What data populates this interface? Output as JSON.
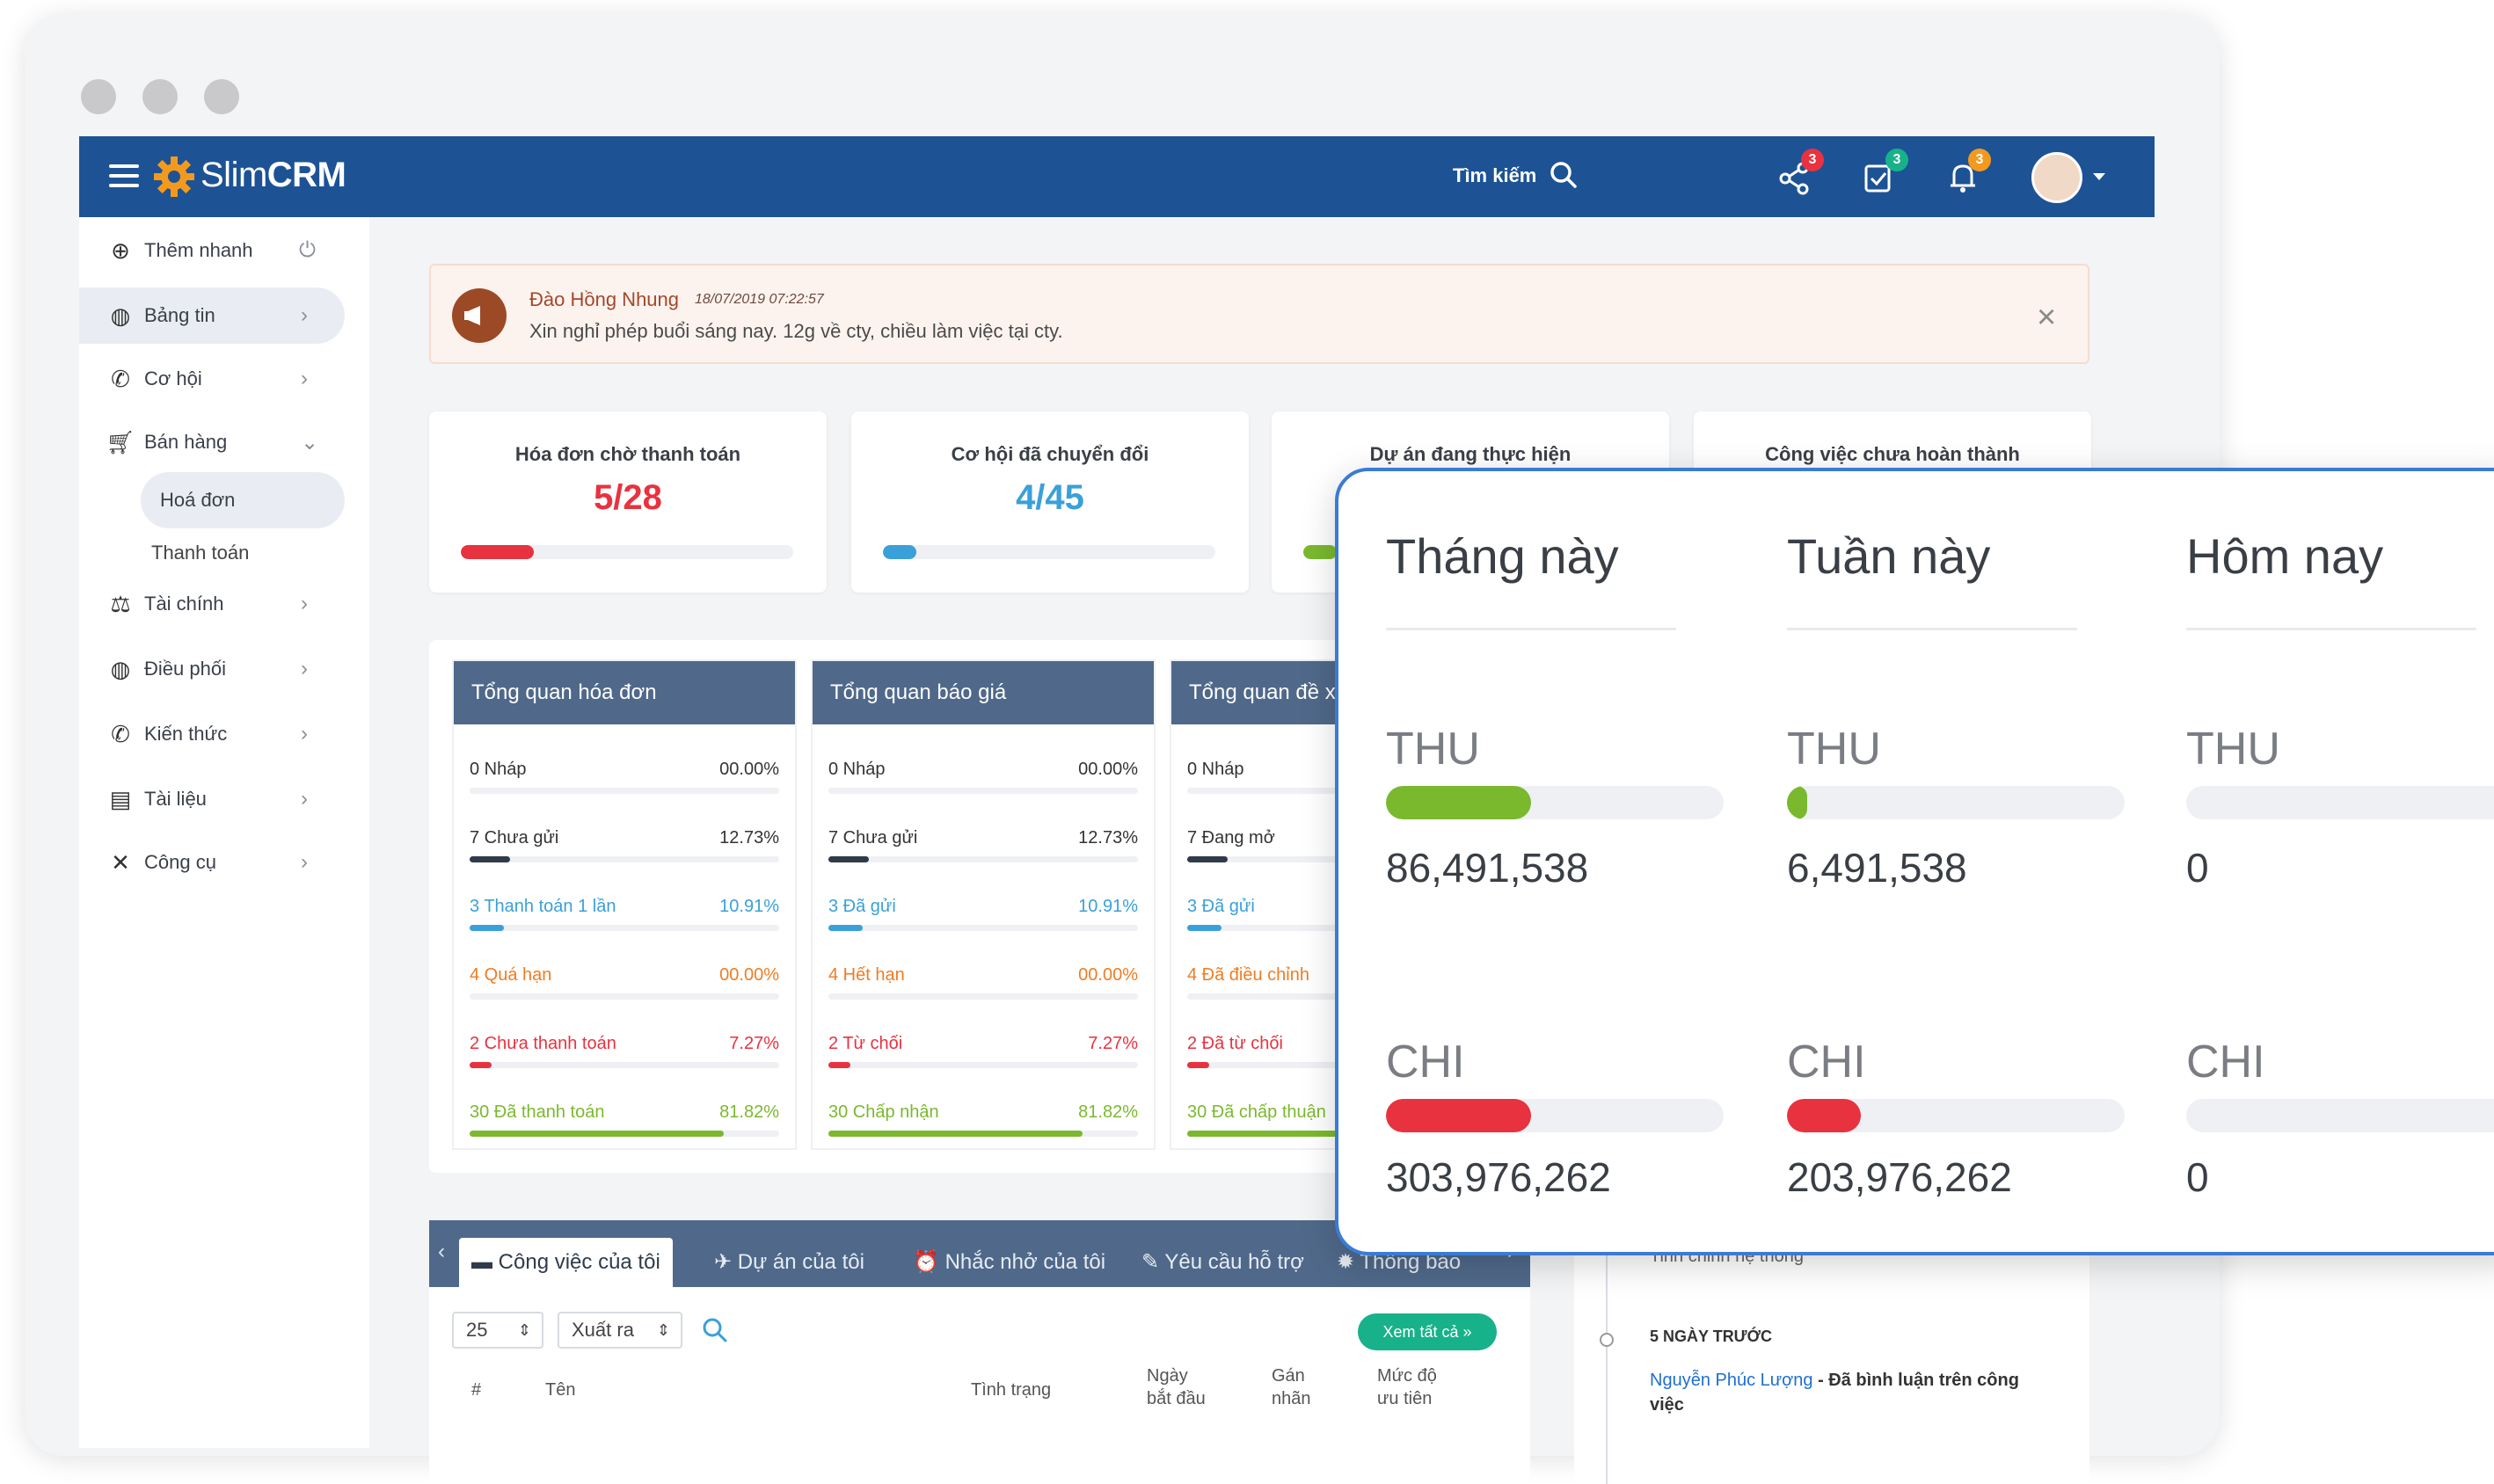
{
  "app": {
    "logo_light": "Slim",
    "logo_bold": "CRM"
  },
  "topbar": {
    "search_label": "Tìm kiếm",
    "badges": {
      "share": "3",
      "tasks": "3",
      "bell": "3"
    }
  },
  "sidebar": {
    "quick_add": "Thêm nhanh",
    "items": [
      {
        "label": "Bảng tin",
        "icon": "dashboard-icon"
      },
      {
        "label": "Cơ hội",
        "icon": "phone-icon"
      },
      {
        "label": "Bán hàng",
        "icon": "cart-icon"
      },
      {
        "label": "Tài chính",
        "icon": "scale-icon"
      },
      {
        "label": "Điều phối",
        "icon": "dashboard-icon"
      },
      {
        "label": "Kiến thức",
        "icon": "phone-icon"
      },
      {
        "label": "Tài liệu",
        "icon": "file-icon"
      },
      {
        "label": "Công cụ",
        "icon": "tools-icon"
      }
    ],
    "sub_items": [
      "Hoá đơn",
      "Thanh toán"
    ]
  },
  "notification": {
    "name": "Đào Hồng Nhung",
    "date": "18/07/2019 07:22:57",
    "message": "Xin nghỉ phép buổi sáng nay. 12g về cty, chiều làm việc tại cty."
  },
  "stats": [
    {
      "title": "Hóa đơn chờ thanh toán",
      "value": "5/28",
      "fill": 0.22,
      "color": "#e8323f"
    },
    {
      "title": "Cơ hội đã chuyển đổi",
      "value": "4/45",
      "fill": 0.1,
      "color": "#3aa0d9"
    },
    {
      "title": "Dự án đang thực hiện",
      "value": "",
      "fill": 0.1,
      "color": "#7ab92e"
    },
    {
      "title": "Công việc chưa hoàn thành",
      "value": "",
      "fill": 0.0,
      "color": "#7ab92e"
    }
  ],
  "overview": [
    {
      "title": "Tổng quan hóa đơn",
      "rows": [
        {
          "label": "0 Nháp",
          "pct": "00.00%",
          "fill": 0.0,
          "color": "#333333"
        },
        {
          "label": "7 Chưa gửi",
          "pct": "12.73%",
          "fill": 0.13,
          "color": "#2f3b4a"
        },
        {
          "label": "3 Thanh toán 1 lần",
          "pct": "10.91%",
          "fill": 0.11,
          "color": "#3aa0d9"
        },
        {
          "label": "4 Quá hạn",
          "pct": "00.00%",
          "fill": 0.0,
          "color": "#f07c22"
        },
        {
          "label": "2 Chưa thanh toán",
          "pct": "7.27%",
          "fill": 0.07,
          "color": "#e8323f"
        },
        {
          "label": "30 Đã thanh toán",
          "pct": "81.82%",
          "fill": 0.82,
          "color": "#7ab92e"
        }
      ]
    },
    {
      "title": "Tổng quan báo giá",
      "rows": [
        {
          "label": "0 Nháp",
          "pct": "00.00%",
          "fill": 0.0,
          "color": "#333333"
        },
        {
          "label": "7 Chưa gửi",
          "pct": "12.73%",
          "fill": 0.13,
          "color": "#2f3b4a"
        },
        {
          "label": "3 Đã gửi",
          "pct": "10.91%",
          "fill": 0.11,
          "color": "#3aa0d9"
        },
        {
          "label": "4 Hết hạn",
          "pct": "00.00%",
          "fill": 0.0,
          "color": "#f07c22"
        },
        {
          "label": "2 Từ chối",
          "pct": "7.27%",
          "fill": 0.07,
          "color": "#e8323f"
        },
        {
          "label": "30 Chấp nhận",
          "pct": "81.82%",
          "fill": 0.82,
          "color": "#7ab92e"
        }
      ]
    },
    {
      "title": "Tổng quan đề xuất",
      "rows": [
        {
          "label": "0 Nháp",
          "pct": "",
          "fill": 0.0,
          "color": "#333333"
        },
        {
          "label": "7 Đang mở",
          "pct": "",
          "fill": 0.13,
          "color": "#2f3b4a"
        },
        {
          "label": "3 Đã gửi",
          "pct": "",
          "fill": 0.11,
          "color": "#3aa0d9"
        },
        {
          "label": "4 Đã điều chỉnh",
          "pct": "",
          "fill": 0.0,
          "color": "#f07c22"
        },
        {
          "label": "2 Đã từ chối",
          "pct": "",
          "fill": 0.07,
          "color": "#e8323f"
        },
        {
          "label": "30 Đã chấp thuận",
          "pct": "",
          "fill": 0.82,
          "color": "#7ab92e"
        }
      ]
    }
  ],
  "tabs": [
    "Công việc của tôi",
    "Dự án của tôi",
    "Nhắc nhở của tôi",
    "Yêu cầu hỗ trợ",
    "Thông báo"
  ],
  "table_controls": {
    "page_size": "25",
    "export": "Xuất ra",
    "see_all": "Xem tất cả »"
  },
  "table_headers": [
    "#",
    "Tên",
    "Tình trạng",
    "Ngày bắt đầu",
    "Gán nhãn",
    "Mức độ ưu tiên"
  ],
  "feed": {
    "prev_text": "Tinh chỉnh hệ thống",
    "time_header": "5 NGÀY TRƯỚC",
    "author": "Nguyễn Phúc Lượng",
    "action": " - Đã bình luận trên công việc"
  },
  "popup": {
    "columns": [
      {
        "title": "Tháng này",
        "income_label": "THU",
        "income": "86,491,538",
        "income_fill": 0.43,
        "expense_label": "CHI",
        "expense": "303,976,262",
        "expense_fill": 0.43
      },
      {
        "title": "Tuần này",
        "income_label": "THU",
        "income": "6,491,538",
        "income_fill": 0.06,
        "expense_label": "CHI",
        "expense": "203,976,262",
        "expense_fill": 0.22
      },
      {
        "title": "Hôm nay",
        "income_label": "THU",
        "income": "0",
        "income_fill": 0.0,
        "expense_label": "CHI",
        "expense": "0",
        "expense_fill": 0.0
      }
    ],
    "colors": {
      "income": "#7ab92e",
      "expense": "#e8323f"
    }
  }
}
